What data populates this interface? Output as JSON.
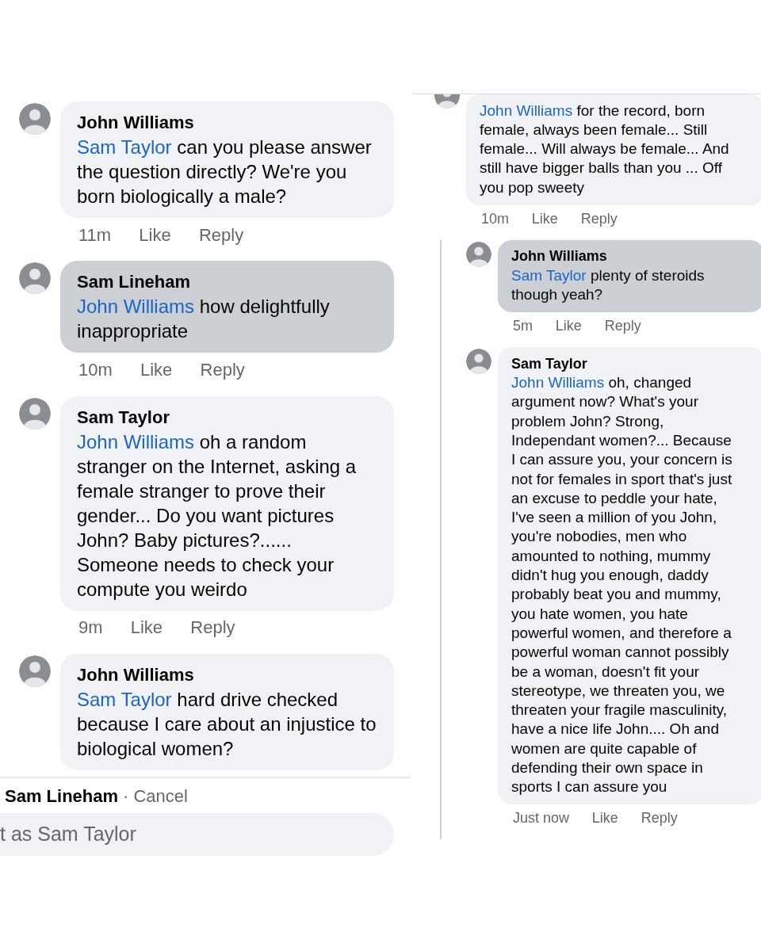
{
  "panels": [
    {
      "comments": [
        {
          "author": "John Williams",
          "mention": "Sam Taylor",
          "text": "can you please answer the question directly? We're you born biologically a male?",
          "time": "11m",
          "like": "Like",
          "reply": "Reply",
          "highlighted": false
        },
        {
          "author": "Sam Lineham",
          "mention": "John Williams",
          "text": "how delightfully inappropriate",
          "time": "10m",
          "like": "Like",
          "reply": "Reply",
          "highlighted": true
        },
        {
          "author": "Sam Taylor",
          "mention": "John Williams",
          "text": "oh a random stranger on the Internet, asking a female stranger to prove their gender... Do you want pictures John? Baby pictures?...... Someone needs to check your compute you weirdo",
          "time": "9m",
          "like": "Like",
          "reply": "Reply",
          "highlighted": false
        },
        {
          "author": "John Williams",
          "mention": "Sam Taylor",
          "text": "hard drive checked because I care about an injustice to biological women?",
          "highlighted": false
        }
      ],
      "reply_bar": {
        "to": "Sam Lineham",
        "cancel": "· Cancel"
      },
      "composer": {
        "placeholder": "t as Sam Taylor"
      }
    },
    {
      "comments": [
        {
          "mention": "John Williams",
          "text": "for the record, born female, always been female... Still female... Will always be female... And still have bigger balls than you ... Off you pop sweety",
          "time": "10m",
          "like": "Like",
          "reply": "Reply",
          "highlighted": false,
          "children": [
            {
              "author": "John Williams",
              "mention": "Sam Taylor",
              "text": "plenty of steroids though yeah?",
              "time": "5m",
              "like": "Like",
              "reply": "Reply",
              "highlighted": true
            },
            {
              "author": "Sam Taylor",
              "mention": "John Williams",
              "text": "oh, changed argument now? What's your problem John? Strong, Independant women?... Because I can assure you, your concern is not for females in sport that's just an excuse to peddle your hate, I've seen a million of you John, you're nobodies, men who amounted to nothing, mummy didn't hug you enough, daddy probably beat you and mummy, you hate women, you hate powerful women, and therefore a powerful woman cannot possibly be a woman, doesn't fit your stereotype, we threaten you, we threaten your fragile masculinity, have a nice life John.... Oh and women are quite capable of defending their own space in sports I can assure you",
              "time": "Just now",
              "like": "Like",
              "reply": "Reply",
              "highlighted": false
            }
          ]
        }
      ]
    }
  ]
}
